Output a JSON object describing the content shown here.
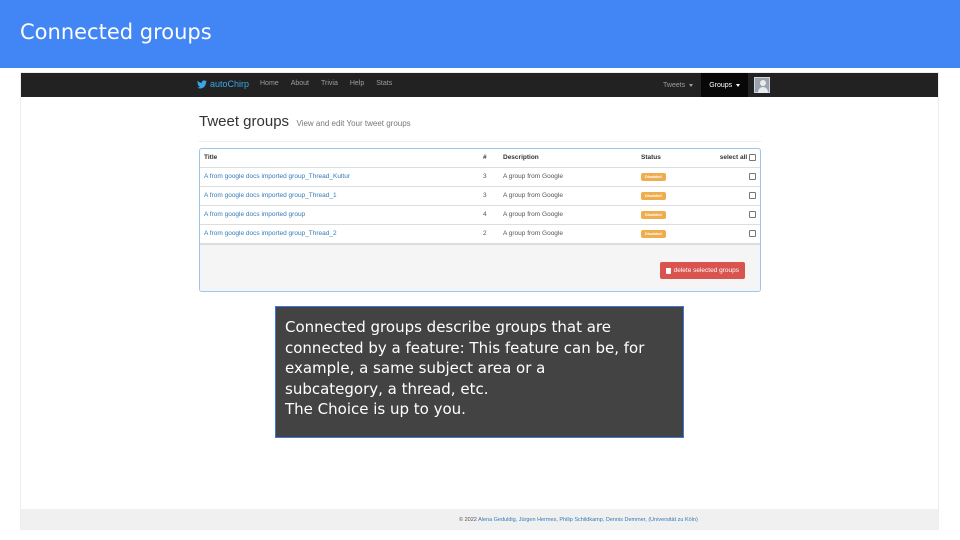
{
  "slide": {
    "title": "Connected groups"
  },
  "navbar": {
    "brand": "autoChirp",
    "brand_icon": "twitter-bird-icon",
    "links": [
      "Home",
      "About",
      "Trivia",
      "Help",
      "Stats"
    ],
    "right": {
      "tweets_label": "Tweets",
      "groups_label": "Groups"
    }
  },
  "page": {
    "heading": "Tweet groups",
    "subheading": "View and edit Your tweet groups"
  },
  "table": {
    "headers": {
      "title": "Title",
      "num": "#",
      "description": "Description",
      "status": "Status",
      "select_all": "select all"
    },
    "rows": [
      {
        "title": "A from google docs imported group_Thread_Kultur",
        "num": "3",
        "description": "A group from Google",
        "status": "Disabled"
      },
      {
        "title": "A from google docs imported group_Thread_1",
        "num": "3",
        "description": "A group from Google",
        "status": "Disabled"
      },
      {
        "title": "A from google docs imported group",
        "num": "4",
        "description": "A group from Google",
        "status": "Disabled"
      },
      {
        "title": "A from google docs imported group_Thread_2",
        "num": "2",
        "description": "A group from Google",
        "status": "Disabled"
      }
    ],
    "delete_button": "delete selected groups"
  },
  "footer": {
    "prefix": "© 2022",
    "authors": "Alena Geduldig, Jürgen Hermes, Philip Schildkamp, Dennis Demmer, (Universität zu Köln)"
  },
  "callout": {
    "lines": [
      "Connected groups describe groups that are",
      "connected by a feature: This feature can be, for",
      "example, a same subject area or a",
      "subcategory, a thread, etc.",
      "The Choice is up to you."
    ]
  },
  "colors": {
    "header_bg": "#4285f4",
    "navbar_bg": "#222222",
    "link": "#337ab7",
    "badge_warning": "#f0ad4e",
    "danger": "#d9534f",
    "callout_bg": "#434343"
  }
}
